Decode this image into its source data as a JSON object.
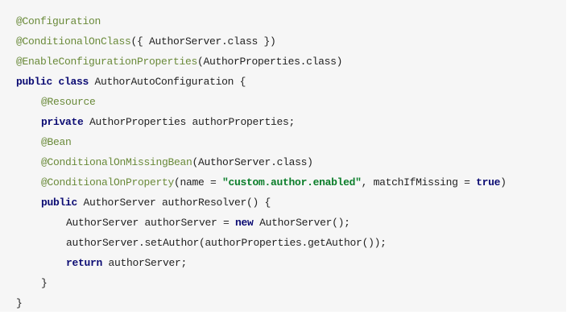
{
  "code": {
    "line1": {
      "annotation": "@Configuration"
    },
    "line2": {
      "annotation": "@ConditionalOnClass",
      "rest": "({ AuthorServer.class })"
    },
    "line3": {
      "annotation": "@EnableConfigurationProperties",
      "rest": "(AuthorProperties.class)"
    },
    "line4": {
      "kw1": "public",
      "kw2": "class",
      "rest": " AuthorAutoConfiguration {"
    },
    "line5": {
      "annotation": "@Resource"
    },
    "line6": {
      "kw": "private",
      "rest": " AuthorProperties authorProperties;"
    },
    "line7": {
      "annotation": "@Bean"
    },
    "line8": {
      "annotation": "@ConditionalOnMissingBean",
      "rest": "(AuthorServer.class)"
    },
    "line9": {
      "annotation": "@ConditionalOnProperty",
      "rest_a": "(name = ",
      "string": "\"custom.author.enabled\"",
      "rest_b": ", matchIfMissing = ",
      "kw": "true",
      "rest_c": ")"
    },
    "line10": {
      "kw": "public",
      "rest": " AuthorServer authorResolver() {"
    },
    "line11": {
      "rest_a": "AuthorServer authorServer = ",
      "kw": "new",
      "rest_b": " AuthorServer();"
    },
    "line12": {
      "rest": "authorServer.setAuthor(authorProperties.getAuthor());"
    },
    "line13": {
      "kw": "return",
      "rest": " authorServer;"
    },
    "line14": {
      "rest": "}"
    },
    "line15": {
      "rest": "}"
    }
  }
}
